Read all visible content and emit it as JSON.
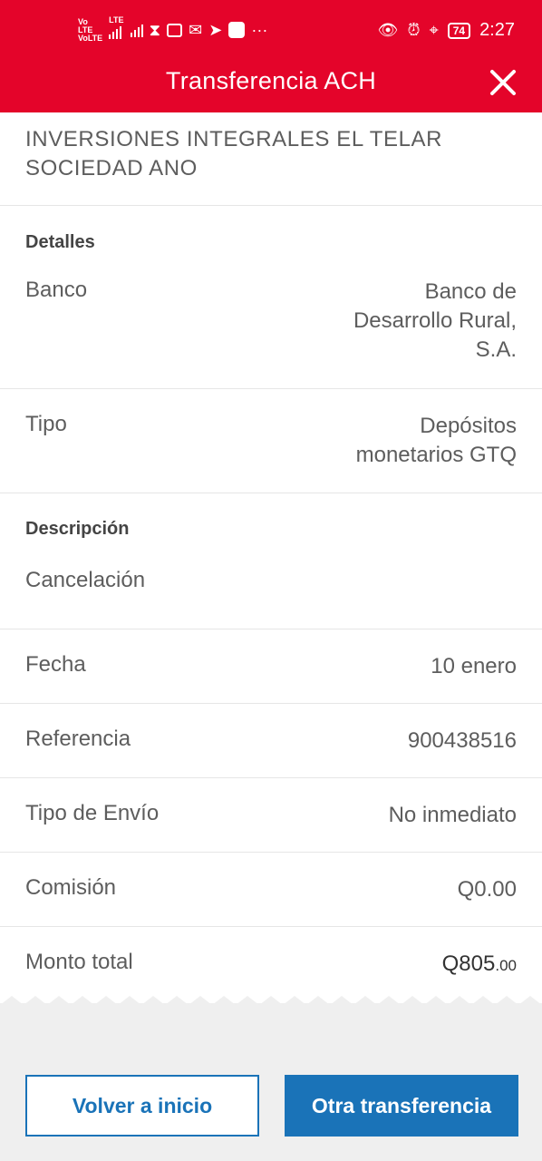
{
  "status_bar": {
    "net1_top": "Vo",
    "net1_mid": "LTE",
    "net1_bot": "VoLTE",
    "net2_top": "LTE",
    "battery": "74",
    "time": "2:27",
    "dots": "···"
  },
  "header": {
    "title": "Transferencia ACH",
    "color": "#e4042a"
  },
  "recipient": {
    "name": "INVERSIONES INTEGRALES EL TELAR SOCIEDAD ANO"
  },
  "details": {
    "section_label": "Detalles",
    "bank_label": "Banco",
    "bank_line1": "Banco de",
    "bank_line2": "Desarrollo Rural,",
    "bank_line3": "S.A.",
    "type_label": "Tipo",
    "type_line1": "Depósitos",
    "type_line2": "monetarios GTQ"
  },
  "description": {
    "section_label": "Descripción",
    "text": "Cancelación"
  },
  "rows": {
    "date_label": "Fecha",
    "date_value": "10 enero",
    "reference_label": "Referencia",
    "reference_value": "900438516",
    "shipping_label": "Tipo de Envío",
    "shipping_value": "No inmediato",
    "commission_label": "Comisión",
    "commission_value": "Q0.00",
    "total_label": "Monto total",
    "total_value_main": "Q805",
    "total_value_cents": ".00"
  },
  "actions": {
    "back_label": "Volver a inicio",
    "another_label": "Otra transferencia",
    "accent": "#1a73b8"
  }
}
